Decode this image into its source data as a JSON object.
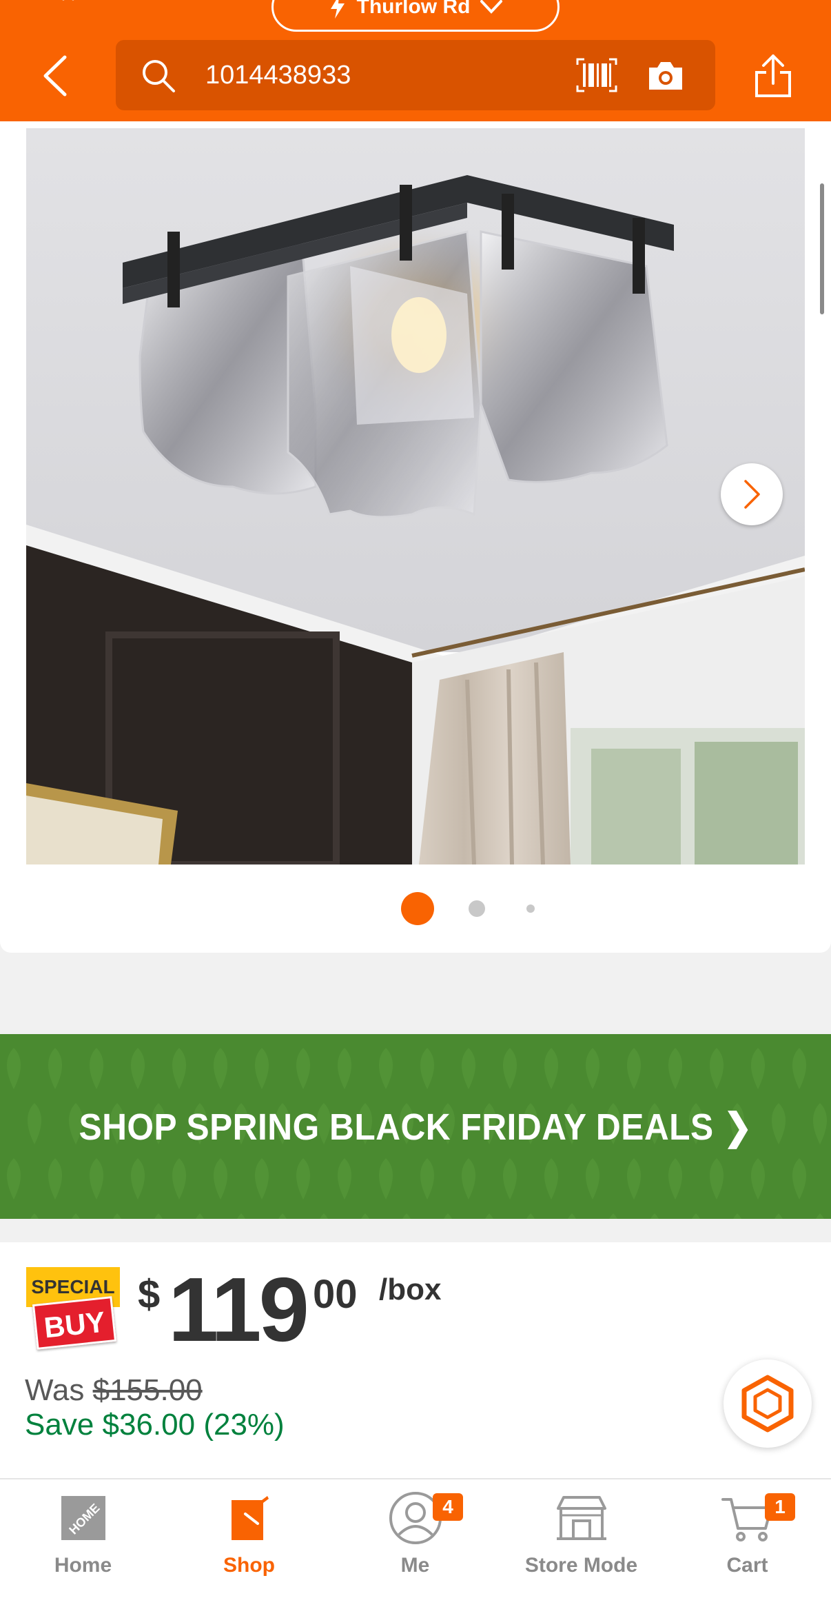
{
  "header": {
    "store_label": "Thurlow Rd",
    "search_query": "1014438933",
    "brand_color": "#f96302"
  },
  "gallery": {
    "image_count": 3,
    "active_index": 0,
    "image_alt": "Flush mount ceiling light with hammered glass panels"
  },
  "promo": {
    "text": "SHOP SPRING BLACK FRIDAY DEALS ❯",
    "color": "#4a8a30"
  },
  "price": {
    "badge_top": "SPECIAL",
    "badge_bottom": "BUY",
    "currency": "$",
    "dollars": "119",
    "cents": "00",
    "unit": "/box",
    "was_label": "Was ",
    "was_value": "$155.00",
    "save_text": "Save $36.00 (23%)"
  },
  "nav": {
    "items": [
      {
        "label": "Home",
        "active": false
      },
      {
        "label": "Shop",
        "active": true
      },
      {
        "label": "Me",
        "active": false,
        "badge": "4"
      },
      {
        "label": "Store Mode",
        "active": false
      },
      {
        "label": "Cart",
        "active": false,
        "badge": "1"
      }
    ]
  }
}
